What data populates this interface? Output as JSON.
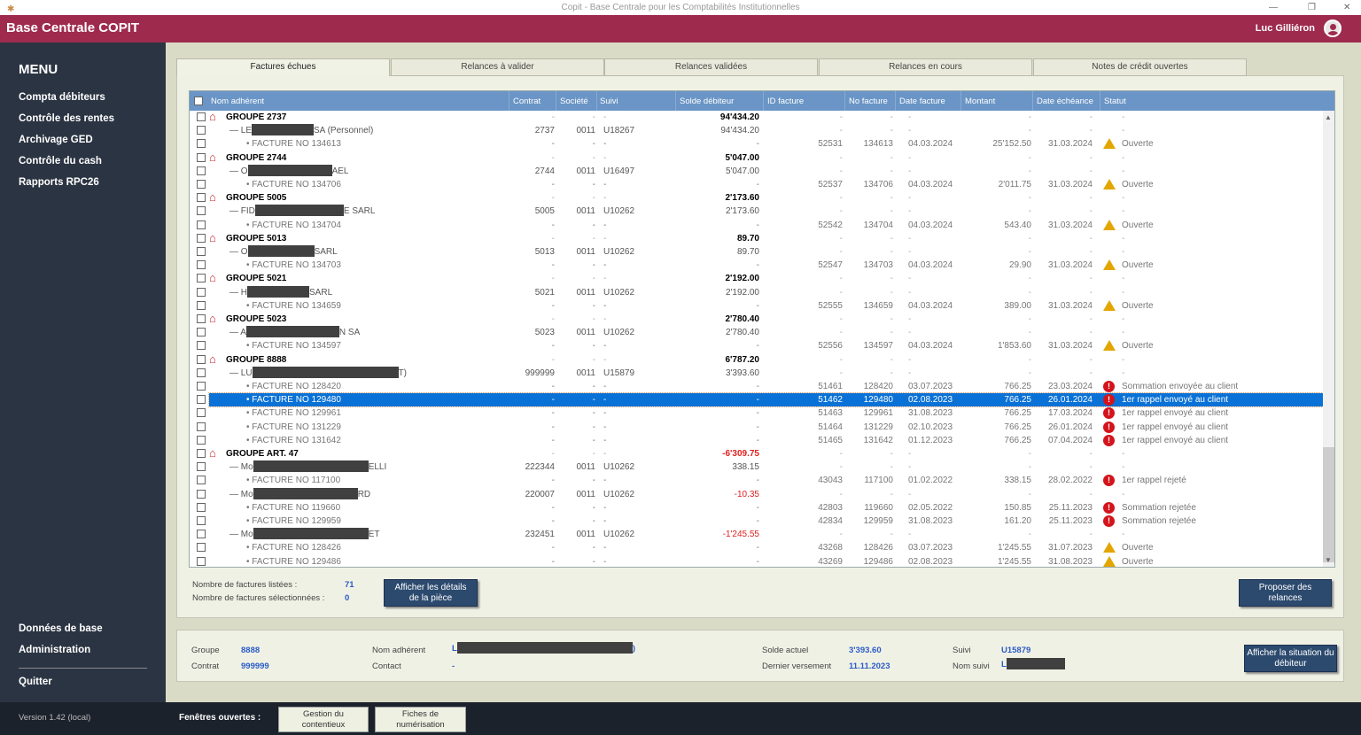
{
  "window": {
    "title": "Copit - Base Centrale pour les Comptabilités Institutionnelles",
    "minimize": "—",
    "restore": "❐",
    "close": "✕"
  },
  "header": {
    "brand": "Base Centrale COPIT",
    "user": "Luc Gilliéron"
  },
  "sidebar": {
    "title": "MENU",
    "items": [
      "Compta débiteurs",
      "Contrôle des rentes",
      "Archivage GED",
      "Contrôle du cash",
      "Rapports RPC26"
    ],
    "bottom_items": [
      "Données de base",
      "Administration"
    ],
    "quit": "Quitter"
  },
  "footer": {
    "version": "Version 1.42 (local)",
    "open_windows_label": "Fenêtres ouvertes :",
    "open_windows": [
      "Gestion du contentieux",
      "Fiches de numérisation"
    ]
  },
  "tabs": [
    "Factures échues",
    "Relances à valider",
    "Relances validées",
    "Relances en cours",
    "Notes de crédit ouvertes"
  ],
  "table": {
    "columns": [
      "Nom adhérent",
      "Contrat",
      "Société",
      "Suivi",
      "Solde débiteur",
      "ID facture",
      "No facture",
      "Date facture",
      "Montant",
      "Date échéance",
      "Statut"
    ],
    "rows": [
      {
        "t": "group",
        "name": "GROUPE 2737",
        "solde": "94'434.20"
      },
      {
        "t": "member",
        "pre": "LE",
        "post": "SA (Personnel)",
        "contrat": "2737",
        "societe": "0011",
        "suivi": "U18267",
        "solde": "94'434.20"
      },
      {
        "t": "inv",
        "name": "FACTURE NO 134613",
        "id": "52531",
        "no": "134613",
        "date": "04.03.2024",
        "montant": "25'152.50",
        "ech": "31.03.2024",
        "icon": "warn",
        "statut": "Ouverte"
      },
      {
        "t": "group",
        "name": "GROUPE 2744",
        "solde": "5'047.00"
      },
      {
        "t": "member",
        "pre": "O",
        "post": "AEL",
        "contrat": "2744",
        "societe": "0011",
        "suivi": "U16497",
        "solde": "5'047.00"
      },
      {
        "t": "inv",
        "name": "FACTURE NO 134706",
        "id": "52537",
        "no": "134706",
        "date": "04.03.2024",
        "montant": "2'011.75",
        "ech": "31.03.2024",
        "icon": "warn",
        "statut": "Ouverte"
      },
      {
        "t": "group",
        "name": "GROUPE 5005",
        "solde": "2'173.60"
      },
      {
        "t": "member",
        "pre": "FID",
        "post": "E SARL",
        "contrat": "5005",
        "societe": "0011",
        "suivi": "U10262",
        "solde": "2'173.60"
      },
      {
        "t": "inv",
        "name": "FACTURE NO 134704",
        "id": "52542",
        "no": "134704",
        "date": "04.03.2024",
        "montant": "543.40",
        "ech": "31.03.2024",
        "icon": "warn",
        "statut": "Ouverte"
      },
      {
        "t": "group",
        "name": "GROUPE 5013",
        "solde": "89.70"
      },
      {
        "t": "member",
        "pre": "O",
        "post": "SARL",
        "contrat": "5013",
        "societe": "0011",
        "suivi": "U10262",
        "solde": "89.70"
      },
      {
        "t": "inv",
        "name": "FACTURE NO 134703",
        "id": "52547",
        "no": "134703",
        "date": "04.03.2024",
        "montant": "29.90",
        "ech": "31.03.2024",
        "icon": "warn",
        "statut": "Ouverte"
      },
      {
        "t": "group",
        "name": "GROUPE 5021",
        "solde": "2'192.00"
      },
      {
        "t": "member",
        "pre": "H",
        "post": "SARL",
        "contrat": "5021",
        "societe": "0011",
        "suivi": "U10262",
        "solde": "2'192.00"
      },
      {
        "t": "inv",
        "name": "FACTURE NO 134659",
        "id": "52555",
        "no": "134659",
        "date": "04.03.2024",
        "montant": "389.00",
        "ech": "31.03.2024",
        "icon": "warn",
        "statut": "Ouverte"
      },
      {
        "t": "group",
        "name": "GROUPE 5023",
        "solde": "2'780.40"
      },
      {
        "t": "member",
        "pre": "A",
        "post": "N SA",
        "contrat": "5023",
        "societe": "0011",
        "suivi": "U10262",
        "solde": "2'780.40"
      },
      {
        "t": "inv",
        "name": "FACTURE NO 134597",
        "id": "52556",
        "no": "134597",
        "date": "04.03.2024",
        "montant": "1'853.60",
        "ech": "31.03.2024",
        "icon": "warn",
        "statut": "Ouverte"
      },
      {
        "t": "group",
        "name": "GROUPE 8888",
        "solde": "6'787.20"
      },
      {
        "t": "member",
        "pre": "LU",
        "post": "T)",
        "contrat": "999999",
        "societe": "0011",
        "suivi": "U15879",
        "solde": "3'393.60"
      },
      {
        "t": "inv",
        "name": "FACTURE NO 128420",
        "id": "51461",
        "no": "128420",
        "date": "03.07.2023",
        "montant": "766.25",
        "ech": "23.03.2024",
        "icon": "err",
        "statut": "Sommation envoyée au client"
      },
      {
        "t": "inv",
        "sel": true,
        "name": "FACTURE NO 129480",
        "id": "51462",
        "no": "129480",
        "date": "02.08.2023",
        "montant": "766.25",
        "ech": "26.01.2024",
        "icon": "err",
        "statut": "1er rappel envoyé au client"
      },
      {
        "t": "inv",
        "name": "FACTURE NO 129961",
        "id": "51463",
        "no": "129961",
        "date": "31.08.2023",
        "montant": "766.25",
        "ech": "17.03.2024",
        "icon": "err",
        "statut": "1er rappel envoyé au client"
      },
      {
        "t": "inv",
        "name": "FACTURE NO 131229",
        "id": "51464",
        "no": "131229",
        "date": "02.10.2023",
        "montant": "766.25",
        "ech": "26.01.2024",
        "icon": "err",
        "statut": "1er rappel envoyé au client"
      },
      {
        "t": "inv",
        "name": "FACTURE NO 131642",
        "id": "51465",
        "no": "131642",
        "date": "01.12.2023",
        "montant": "766.25",
        "ech": "07.04.2024",
        "icon": "err",
        "statut": "1er rappel envoyé au client"
      },
      {
        "t": "group",
        "name": "GROUPE ART. 47",
        "solde": "-6'309.75",
        "neg": true
      },
      {
        "t": "member",
        "pre": "Mo",
        "post": "ELLI",
        "contrat": "222344",
        "societe": "0011",
        "suivi": "U10262",
        "solde": "338.15"
      },
      {
        "t": "inv",
        "name": "FACTURE NO 117100",
        "id": "43043",
        "no": "117100",
        "date": "01.02.2022",
        "montant": "338.15",
        "ech": "28.02.2022",
        "icon": "err",
        "statut": "1er rappel rejeté"
      },
      {
        "t": "member",
        "pre": "Mo",
        "post": "RD",
        "contrat": "220007",
        "societe": "0011",
        "suivi": "U10262",
        "solde": "-10.35",
        "neg": true
      },
      {
        "t": "inv",
        "name": "FACTURE NO 119660",
        "id": "42803",
        "no": "119660",
        "date": "02.05.2022",
        "montant": "150.85",
        "ech": "25.11.2023",
        "icon": "err",
        "statut": "Sommation rejetée"
      },
      {
        "t": "inv",
        "name": "FACTURE NO 129959",
        "id": "42834",
        "no": "129959",
        "date": "31.08.2023",
        "montant": "161.20",
        "ech": "25.11.2023",
        "icon": "err",
        "statut": "Sommation rejetée"
      },
      {
        "t": "member",
        "pre": "Mo",
        "post": "ET",
        "contrat": "232451",
        "societe": "0011",
        "suivi": "U10262",
        "solde": "-1'245.55",
        "neg": true
      },
      {
        "t": "inv",
        "name": "FACTURE NO 128426",
        "id": "43268",
        "no": "128426",
        "date": "03.07.2023",
        "montant": "1'245.55",
        "ech": "31.07.2023",
        "icon": "warn",
        "statut": "Ouverte"
      },
      {
        "t": "inv",
        "name": "FACTURE NO 129486",
        "id": "43269",
        "no": "129486",
        "date": "02.08.2023",
        "montant": "1'245.55",
        "ech": "31.08.2023",
        "icon": "warn",
        "statut": "Ouverte"
      }
    ],
    "dash": "-"
  },
  "stats": {
    "listed_label": "Nombre de factures listées :",
    "listed": "71",
    "selected_label": "Nombre de factures sélectionnées :",
    "selected": "0"
  },
  "buttons": {
    "details": "Afficher les détails de la pièce",
    "propose": "Proposer des relances",
    "situation": "Afficher la situation du débiteur"
  },
  "info": {
    "groupe_label": "Groupe",
    "groupe": "8888",
    "contrat_label": "Contrat",
    "contrat": "999999",
    "nom_label": "Nom adhérent",
    "nom_pre": "L",
    "nom_post": ")",
    "contact_label": "Contact",
    "contact": "-",
    "solde_label": "Solde actuel",
    "solde": "3'393.60",
    "versement_label": "Dernier versement",
    "versement": "11.11.2023",
    "suivi_label": "Suivi",
    "suivi": "U15879",
    "nomsuivi_label": "Nom suivi",
    "nomsuivi_pre": "L"
  }
}
